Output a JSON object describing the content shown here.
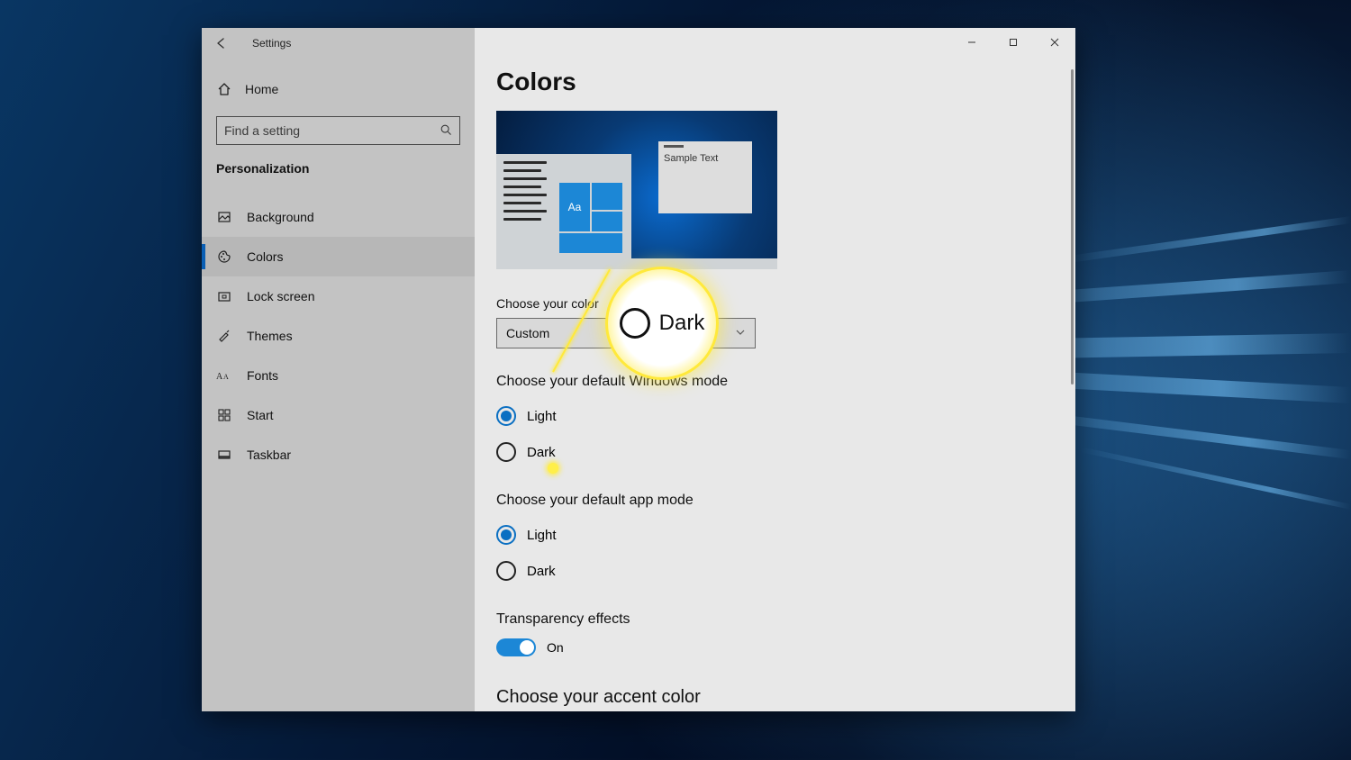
{
  "app_title": "Settings",
  "sidebar": {
    "home": "Home",
    "search_placeholder": "Find a setting",
    "section": "Personalization",
    "items": [
      {
        "icon": "image-icon",
        "label": "Background"
      },
      {
        "icon": "palette-icon",
        "label": "Colors"
      },
      {
        "icon": "lock-icon",
        "label": "Lock screen"
      },
      {
        "icon": "themes-icon",
        "label": "Themes"
      },
      {
        "icon": "fonts-icon",
        "label": "Fonts"
      },
      {
        "icon": "start-icon",
        "label": "Start"
      },
      {
        "icon": "taskbar-icon",
        "label": "Taskbar"
      }
    ],
    "active_index": 1
  },
  "content": {
    "page_title": "Colors",
    "preview_sample_text": "Sample Text",
    "preview_aa": "Aa",
    "choose_color_label": "Choose your color",
    "choose_color_value": "Custom",
    "windows_mode": {
      "heading": "Choose your default Windows mode",
      "options": [
        "Light",
        "Dark"
      ],
      "selected": 0
    },
    "app_mode": {
      "heading": "Choose your default app mode",
      "options": [
        "Light",
        "Dark"
      ],
      "selected": 0
    },
    "transparency": {
      "heading": "Transparency effects",
      "state_label": "On",
      "enabled": true
    },
    "accent_heading": "Choose your accent color"
  },
  "callout": {
    "label": "Dark"
  }
}
